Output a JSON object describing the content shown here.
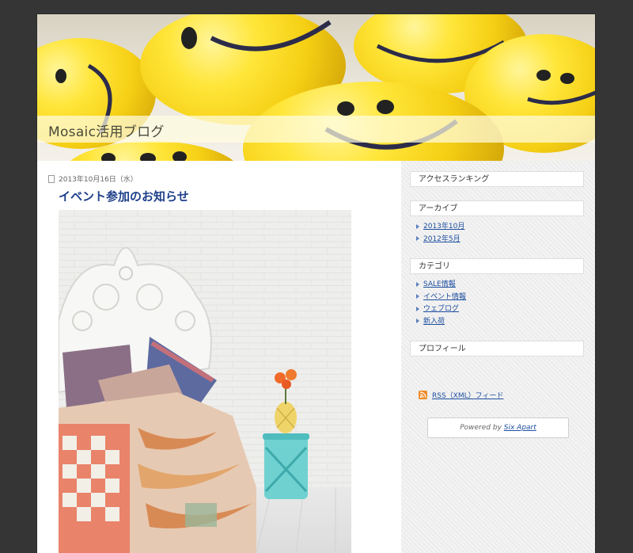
{
  "header": {
    "blog_title": "Mosaic活用ブログ"
  },
  "entry": {
    "date": "2013年10月16日（水）",
    "title": "イベント参加のお知らせ"
  },
  "sidebar": {
    "access_ranking": {
      "title": "アクセスランキング"
    },
    "archives": {
      "title": "アーカイブ",
      "items": [
        "2013年10月",
        "2012年5月"
      ]
    },
    "categories": {
      "title": "カテゴリ",
      "items": [
        "SALE情報",
        "イベント情報",
        "ウェブログ",
        "新入荷"
      ]
    },
    "profile": {
      "title": "プロフィール"
    },
    "rss_label": "RSS（XML）フィード",
    "powered_by": {
      "prefix": "Powered by ",
      "link": "Six Apart"
    }
  },
  "colors": {
    "background": "#353535",
    "link": "#1e4fa0",
    "entry_title": "#1e3f8a",
    "rss": "#f08a24"
  },
  "icons": [
    "document-icon",
    "bullet-arrow-icon",
    "rss-icon"
  ]
}
